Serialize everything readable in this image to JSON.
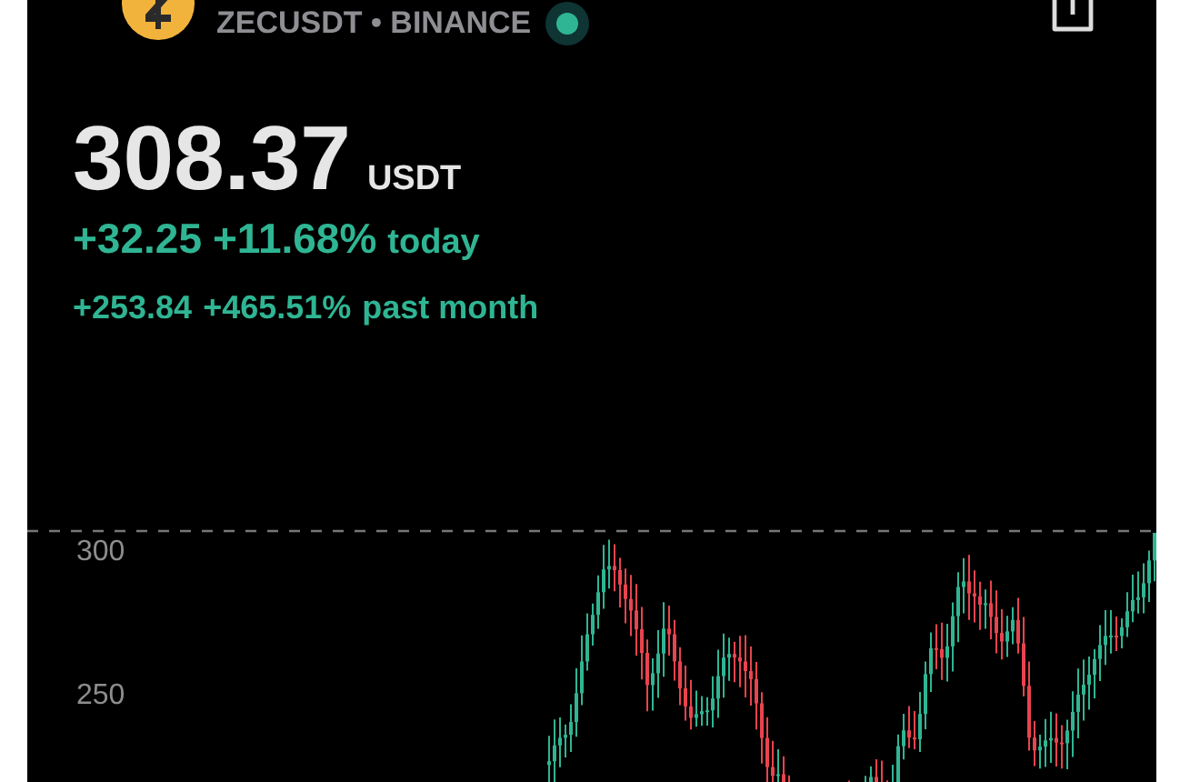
{
  "header": {
    "symbol": "ZECUSDT • BINANCE"
  },
  "price": {
    "value": "308.37",
    "unit": "USDT"
  },
  "changes": [
    {
      "kind": "today",
      "amount": "+32.25",
      "percent": "+11.68%",
      "label": "today"
    },
    {
      "kind": "month",
      "amount": "+253.84",
      "percent": "+465.51%",
      "label": "past month"
    }
  ],
  "chart": {
    "axis_labels": [
      "300",
      "250"
    ]
  }
}
